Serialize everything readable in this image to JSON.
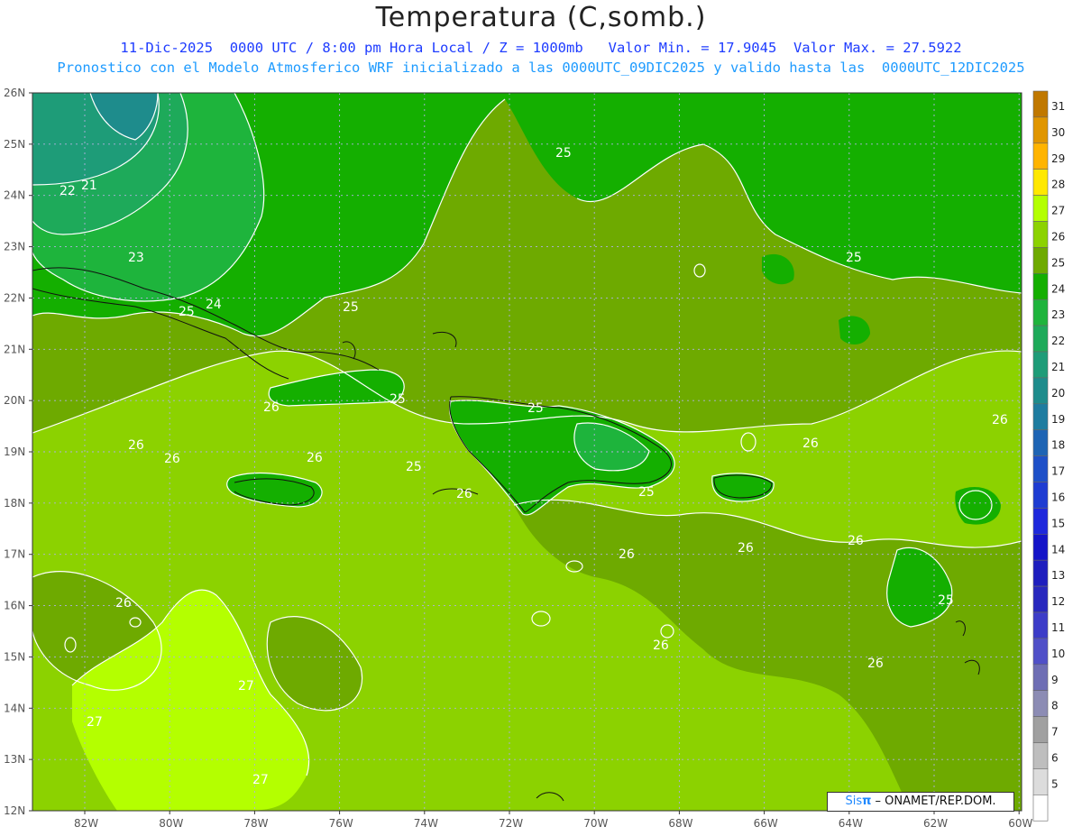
{
  "header": {
    "title": "Temperatura (C,somb.)",
    "line1": "11-Dic-2025  0000 UTC / 8:00 pm Hora Local / Z = 1000mb   Valor Min. = 17.9045  Valor Max. = 27.5922",
    "line2": "Pronostico con el Modelo Atmosferico WRF inicializado a las 0000UTC_09DIC2025 y valido hasta las  0000UTC_12DIC2025"
  },
  "map": {
    "lat_labels": [
      "26N",
      "25N",
      "24N",
      "23N",
      "22N",
      "21N",
      "20N",
      "19N",
      "18N",
      "17N",
      "16N",
      "15N",
      "14N",
      "13N",
      "12N"
    ],
    "lon_labels": [
      "82W",
      "80W",
      "78W",
      "76W",
      "74W",
      "72W",
      "70W",
      "68W",
      "66W",
      "64W",
      "62W",
      "60W"
    ],
    "contour_labels": [
      {
        "text": "22"
      },
      {
        "text": "21"
      },
      {
        "text": "23"
      },
      {
        "text": "25"
      },
      {
        "text": "24"
      },
      {
        "text": "25"
      },
      {
        "text": "25"
      },
      {
        "text": "25"
      },
      {
        "text": "25"
      },
      {
        "text": "25"
      },
      {
        "text": "26"
      },
      {
        "text": "26"
      },
      {
        "text": "26"
      },
      {
        "text": "26"
      },
      {
        "text": "25"
      },
      {
        "text": "26"
      },
      {
        "text": "25"
      },
      {
        "text": "26"
      },
      {
        "text": "26"
      },
      {
        "text": "26"
      },
      {
        "text": "26"
      },
      {
        "text": "26"
      },
      {
        "text": "26"
      },
      {
        "text": "26"
      },
      {
        "text": "27"
      },
      {
        "text": "27"
      },
      {
        "text": "27"
      },
      {
        "text": "26"
      },
      {
        "text": "25"
      }
    ]
  },
  "colorbar": {
    "levels": [
      "31",
      "30",
      "29",
      "28",
      "27",
      "26",
      "25",
      "24",
      "23",
      "22",
      "21",
      "20",
      "19",
      "18",
      "17",
      "16",
      "15",
      "14",
      "13",
      "12",
      "11",
      "10",
      "9",
      "8",
      "7",
      "6",
      "5"
    ],
    "colors": [
      "#c07800",
      "#e09600",
      "#ffb400",
      "#ffe800",
      "#b4ff00",
      "#8cd200",
      "#6eaa00",
      "#14af00",
      "#1eb43c",
      "#1eaa5a",
      "#1e9c78",
      "#1e8c8c",
      "#1e7ca0",
      "#1e64b4",
      "#1e50c8",
      "#1e3cd2",
      "#1e28dc",
      "#1414c8",
      "#1e1ebe",
      "#2828be",
      "#3c3cc8",
      "#5050c8",
      "#6e6eb4",
      "#8c8cb4",
      "#a0a0a0",
      "#bebebe",
      "#dcdcdc",
      "#ffffff"
    ]
  },
  "brand": {
    "prefix": "Sis",
    "pi": "π",
    "suffix": " – ONAMET/REP.DOM."
  }
}
